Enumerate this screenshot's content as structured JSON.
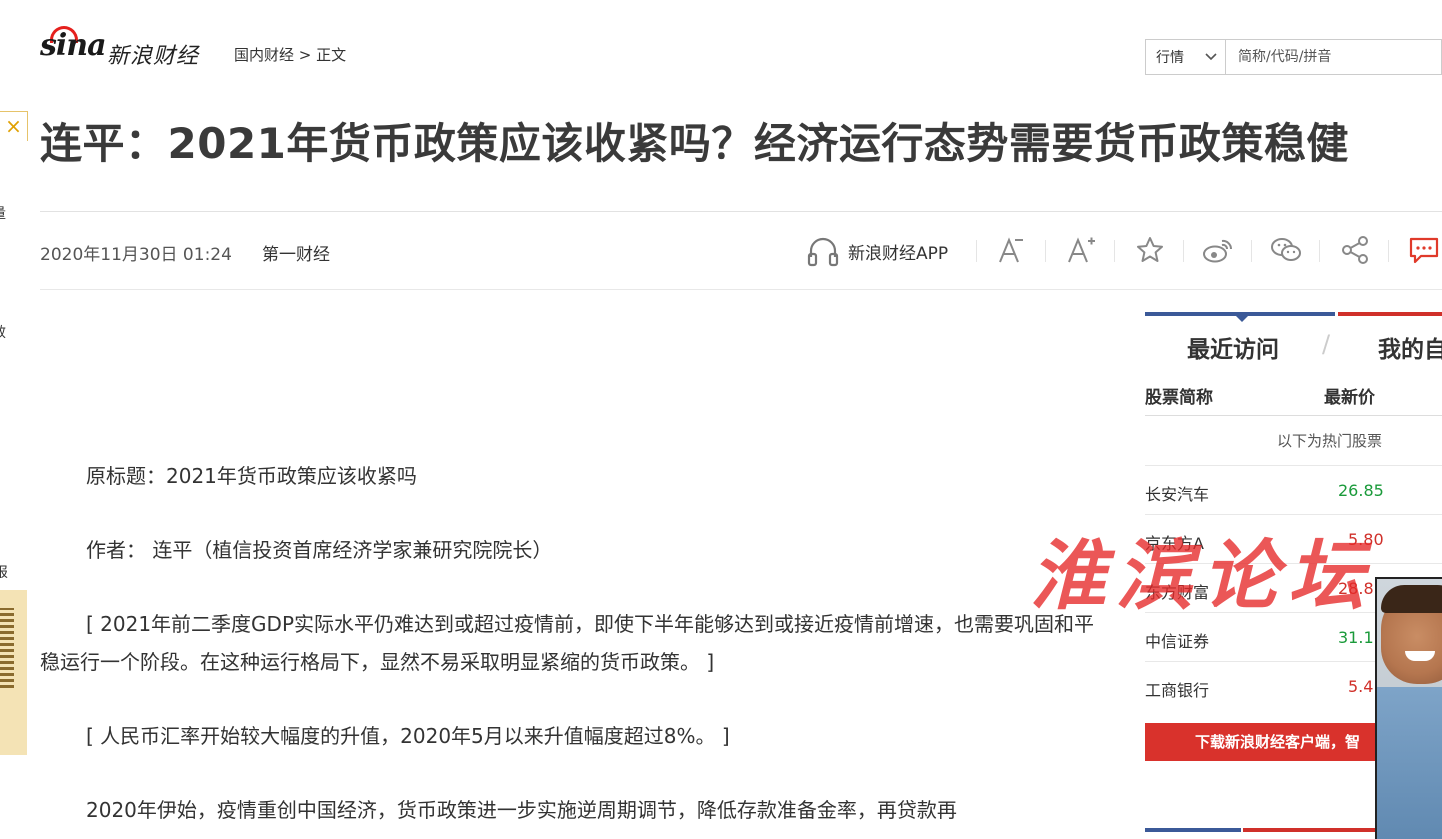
{
  "header": {
    "logo_mark": "sina",
    "logo_text": "新浪财经",
    "breadcrumb": {
      "section": "国内财经",
      "separator": ">",
      "current": "正文"
    },
    "quote_search": {
      "select_value": "行情",
      "placeholder": "简称/代码/拼音"
    }
  },
  "left_strip": {
    "close_glyph": "×",
    "fragments": [
      "量",
      "效",
      "报"
    ]
  },
  "article": {
    "title": "连平：2021年货币政策应该收紧吗？经济运行态势需要货币政策稳健",
    "date": "2020年11月30日 01:24",
    "source": "第一财经",
    "app_link": "新浪财经APP",
    "paragraphs": [
      "原标题：2021年货币政策应该收紧吗",
      "作者： 连平（植信投资首席经济学家兼研究院院长）",
      "[ 2021年前二季度GDP实际水平仍难达到或超过疫情前，即使下半年能够达到或接近疫情前增速，也需要巩固和平稳运行一个阶段。在这种运行格局下，显然不易采取明显紧缩的货币政策。 ]",
      "[ 人民币汇率开始较大幅度的升值，2020年5月以来升值幅度超过8%。 ]",
      "2020年伊始，疫情重创中国经济，货币政策进一步实施逆周期调节，降低存款准备金率，再贷款再"
    ]
  },
  "sidebar": {
    "tab_recent": "最近访问",
    "tab_divider": "/",
    "tab_mine": "我的自",
    "col_name": "股票简称",
    "col_price": "最新价",
    "hot_note": "以下为热门股票",
    "stocks": [
      {
        "name": "长安汽车",
        "price": "26.85",
        "color": "#1a9a3a"
      },
      {
        "name": "京东方A",
        "price": "5.80",
        "color": "#d0302a"
      },
      {
        "name": "东方财富",
        "price": "28.8",
        "color": "#d0302a"
      },
      {
        "name": "中信证券",
        "price": "31.1",
        "color": "#1a9a3a"
      },
      {
        "name": "工商银行",
        "price": "5.4",
        "color": "#d0302a"
      }
    ],
    "download_button": "下载新浪财经客户端，智"
  },
  "watermark": "淮滨论坛",
  "colors": {
    "brand_red": "#e5201d",
    "tab_blue": "#3b5998",
    "tab_red": "#d0302a",
    "up_red": "#d0302a",
    "down_green": "#1a9a3a"
  },
  "icons": [
    "headphones-icon",
    "font-decrease-icon",
    "font-increase-icon",
    "star-icon",
    "weibo-icon",
    "wechat-icon",
    "share-icon",
    "comment-icon"
  ]
}
